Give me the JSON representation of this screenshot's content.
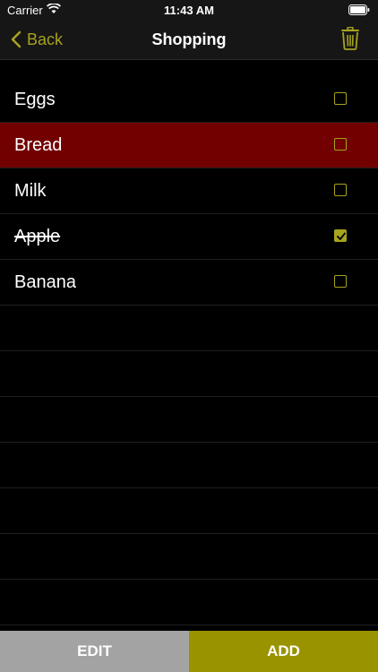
{
  "status_bar": {
    "carrier": "Carrier",
    "time": "11:43 AM"
  },
  "nav": {
    "back_label": "Back",
    "title": "Shopping"
  },
  "items": [
    {
      "label": "Eggs",
      "checked": false,
      "selected": false
    },
    {
      "label": "Bread",
      "checked": false,
      "selected": true
    },
    {
      "label": "Milk",
      "checked": false,
      "selected": false
    },
    {
      "label": "Apple",
      "checked": true,
      "selected": false
    },
    {
      "label": "Banana",
      "checked": false,
      "selected": false
    }
  ],
  "toolbar": {
    "edit_label": "EDIT",
    "add_label": "ADD"
  },
  "colors": {
    "accent": "#a7a31f",
    "selected_row": "#720000",
    "edit_bg": "#a3a3a3",
    "add_bg": "#9a9300"
  },
  "icons": {
    "back": "chevron-left-icon",
    "trash": "trash-icon",
    "wifi": "wifi-icon",
    "battery": "battery-icon"
  }
}
